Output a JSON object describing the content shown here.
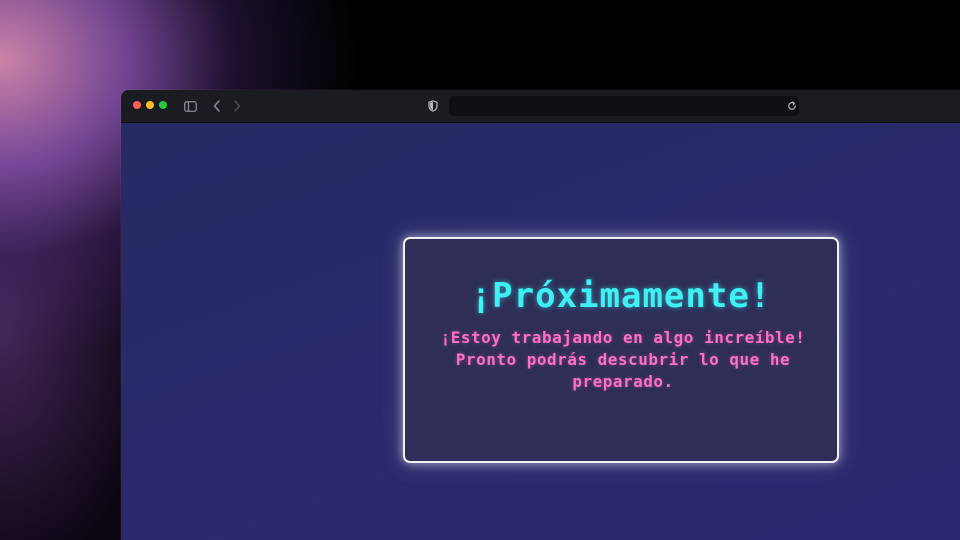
{
  "browser": {
    "address_value": "",
    "traffic_light_colors": [
      "#ff5f57",
      "#febc2e",
      "#28c840"
    ],
    "icons": [
      "sidebar-icon",
      "back-chevron-icon",
      "forward-chevron-icon",
      "shield-icon",
      "reload-icon"
    ]
  },
  "page": {
    "title": "¡Próximamente!",
    "message": "¡Estoy trabajando en algo increíble! Pronto podrás descubrir lo que he preparado."
  },
  "colors": {
    "title": "#3ff0f4",
    "message": "#ff6ec7",
    "page_background": "#2a2a6a",
    "card_border": "#f2f0f7"
  }
}
